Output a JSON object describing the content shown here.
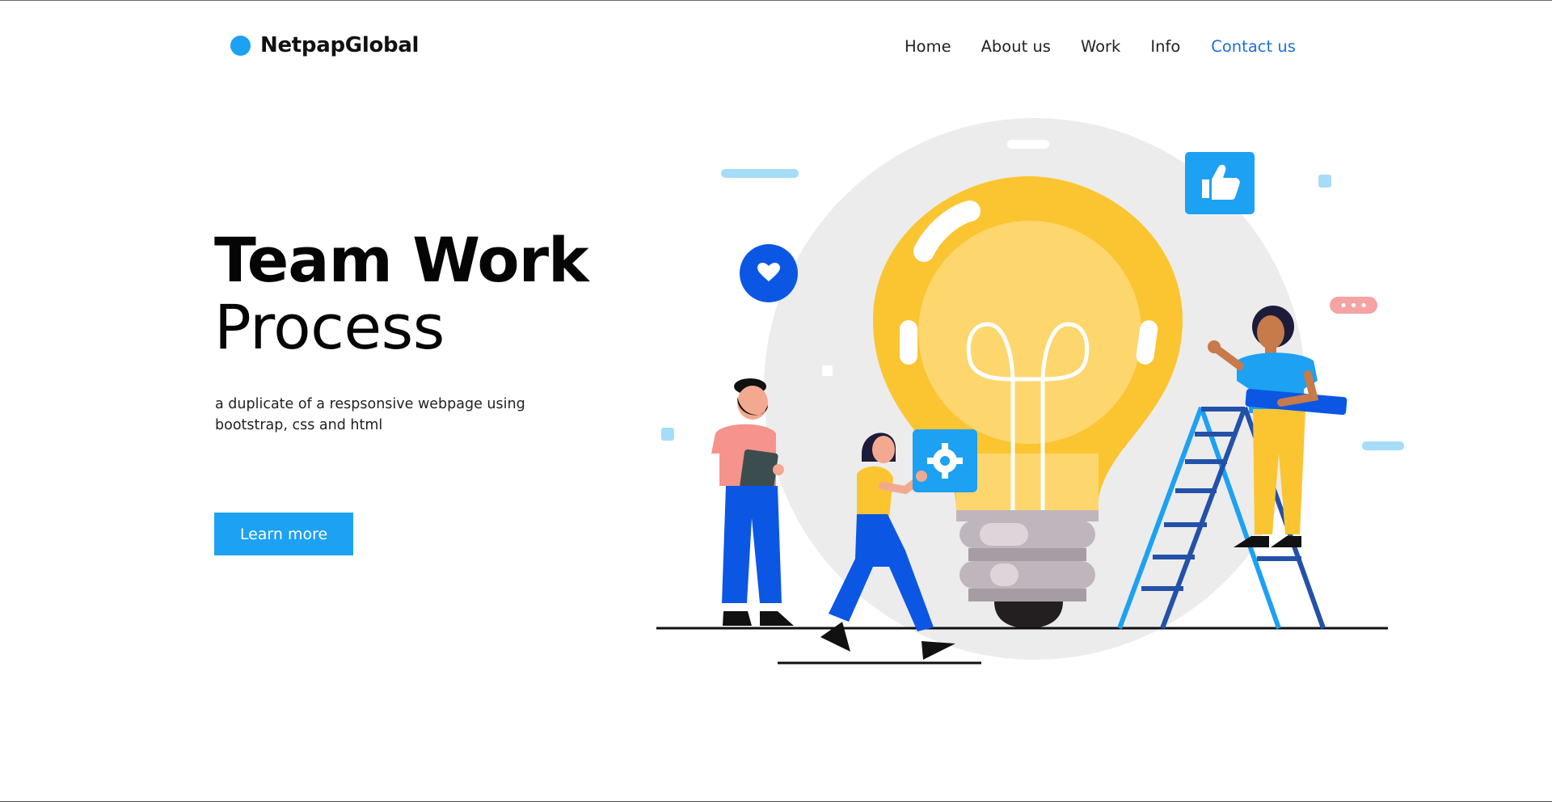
{
  "colors": {
    "brand_blue": "#1da1f2",
    "button_blue": "#1da1f2",
    "nav_active": "#1f6fd6",
    "text_dark": "#111111",
    "bulb_yellow": "#fbc531",
    "circle_gray": "#ececec",
    "pant_blue": "#0b57e3",
    "icon_blue": "#1da1f2",
    "heart_blue": "#0b57e3"
  },
  "brand": {
    "name": "NetpapGlobal",
    "dot_icon": "brand-dot-icon"
  },
  "nav": {
    "items": [
      {
        "label": "Home"
      },
      {
        "label": "About us"
      },
      {
        "label": "Work"
      },
      {
        "label": "Info"
      },
      {
        "label": "Contact us",
        "active": true
      }
    ]
  },
  "hero": {
    "title": "Team Work",
    "subtitle": "Process",
    "description": "a duplicate of a respsonsive webpage using bootstrap, css and html",
    "cta_label": "Learn more"
  },
  "illustration": {
    "icons": [
      "lightbulb-icon",
      "thumbs-up-icon",
      "heart-icon",
      "gear-icon",
      "chat-bubble-icon",
      "ladder-icon"
    ],
    "people": [
      "man-with-tablet",
      "woman-carrying-gear-box",
      "woman-on-ladder"
    ]
  }
}
